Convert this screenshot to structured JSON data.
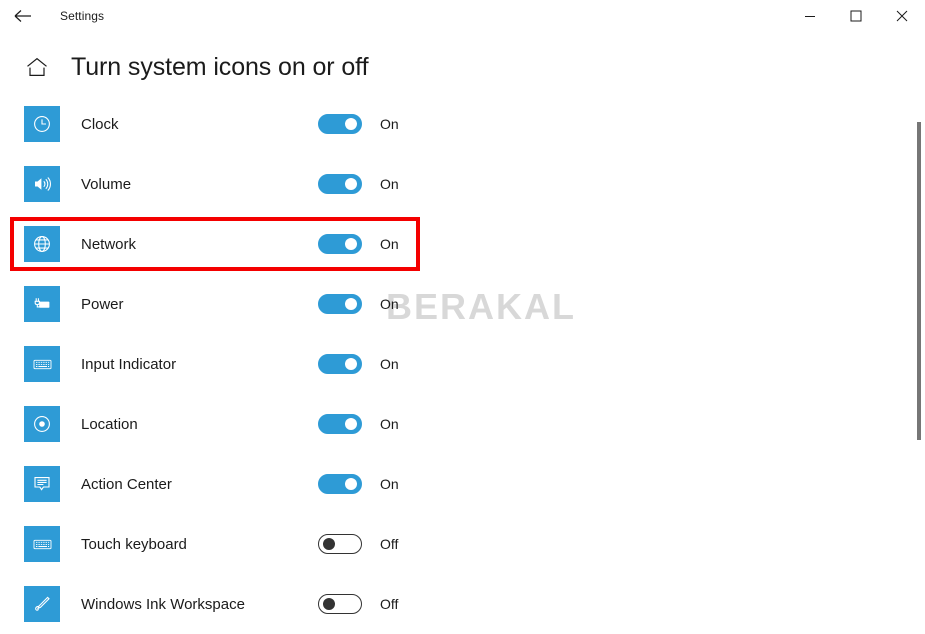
{
  "titlebar": {
    "back_label": "back-arrow",
    "app_title": "Settings",
    "minimize_label": "Minimize",
    "maximize_label": "Maximize",
    "close_label": "Close"
  },
  "header": {
    "home_icon": "home-icon",
    "title": "Turn system icons on or off"
  },
  "watermark": {
    "text": "BERAKAL"
  },
  "colors": {
    "accent": "#2e9bd6",
    "annotation": "#f40000",
    "text": "#1b1b1b",
    "watermark": "#d8d8d8",
    "scrollbar": "#767676"
  },
  "list": {
    "rows": [
      {
        "icon": "clock-icon",
        "label": "Clock",
        "state": "On",
        "on": true
      },
      {
        "icon": "volume-icon",
        "label": "Volume",
        "state": "On",
        "on": true
      },
      {
        "icon": "network-icon",
        "label": "Network",
        "state": "On",
        "on": true
      },
      {
        "icon": "power-icon",
        "label": "Power",
        "state": "On",
        "on": true
      },
      {
        "icon": "input-indicator-icon",
        "label": "Input Indicator",
        "state": "On",
        "on": true
      },
      {
        "icon": "location-icon",
        "label": "Location",
        "state": "On",
        "on": true
      },
      {
        "icon": "action-center-icon",
        "label": "Action Center",
        "state": "On",
        "on": true
      },
      {
        "icon": "touch-keyboard-icon",
        "label": "Touch keyboard",
        "state": "Off",
        "on": false
      },
      {
        "icon": "windows-ink-icon",
        "label": "Windows Ink Workspace",
        "state": "Off",
        "on": false
      }
    ]
  },
  "annotation": {
    "target_row": "Network"
  }
}
